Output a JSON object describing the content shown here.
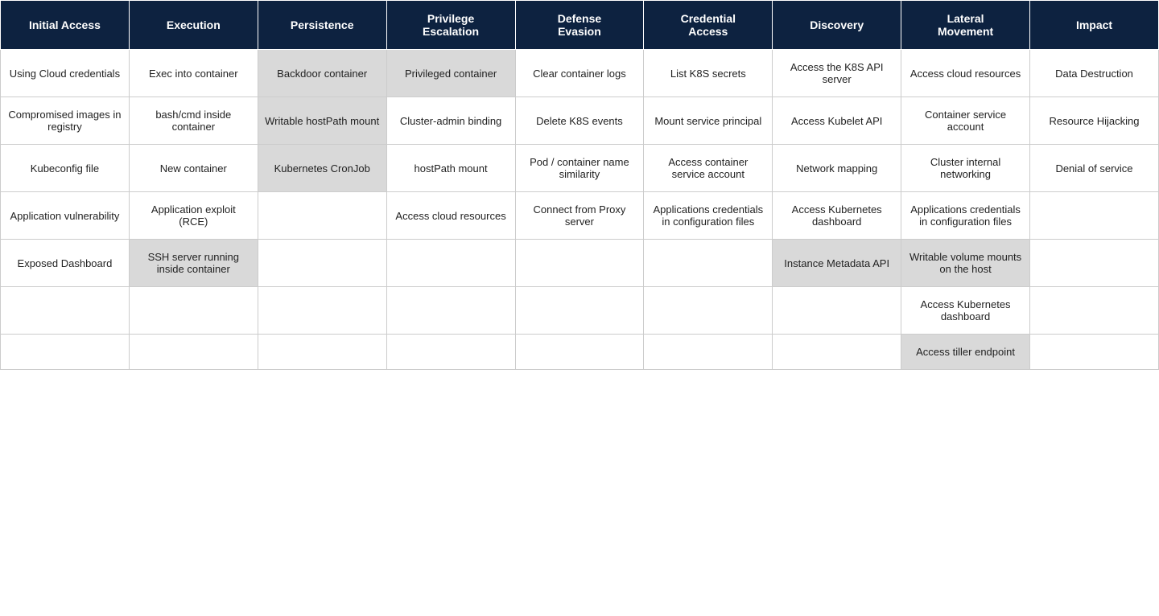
{
  "headers": [
    "Initial Access",
    "Execution",
    "Persistence",
    "Privilege Escalation",
    "Defense Evasion",
    "Credential Access",
    "Discovery",
    "Lateral Movement",
    "Impact"
  ],
  "rows": [
    [
      {
        "text": "Using Cloud credentials",
        "shaded": false
      },
      {
        "text": "Exec into container",
        "shaded": false
      },
      {
        "text": "Backdoor container",
        "shaded": true
      },
      {
        "text": "Privileged container",
        "shaded": true
      },
      {
        "text": "Clear container logs",
        "shaded": false
      },
      {
        "text": "List K8S secrets",
        "shaded": false
      },
      {
        "text": "Access the K8S API server",
        "shaded": false
      },
      {
        "text": "Access cloud resources",
        "shaded": false
      },
      {
        "text": "Data Destruction",
        "shaded": false
      }
    ],
    [
      {
        "text": "Compromised images in registry",
        "shaded": false
      },
      {
        "text": "bash/cmd inside container",
        "shaded": false
      },
      {
        "text": "Writable hostPath mount",
        "shaded": true
      },
      {
        "text": "Cluster-admin binding",
        "shaded": false
      },
      {
        "text": "Delete K8S events",
        "shaded": false
      },
      {
        "text": "Mount service principal",
        "shaded": false
      },
      {
        "text": "Access Kubelet API",
        "shaded": false
      },
      {
        "text": "Container service account",
        "shaded": false
      },
      {
        "text": "Resource Hijacking",
        "shaded": false
      }
    ],
    [
      {
        "text": "Kubeconfig file",
        "shaded": false
      },
      {
        "text": "New container",
        "shaded": false
      },
      {
        "text": "Kubernetes CronJob",
        "shaded": true
      },
      {
        "text": "hostPath mount",
        "shaded": false
      },
      {
        "text": "Pod / container name similarity",
        "shaded": false
      },
      {
        "text": "Access container service account",
        "shaded": false
      },
      {
        "text": "Network mapping",
        "shaded": false
      },
      {
        "text": "Cluster internal networking",
        "shaded": false
      },
      {
        "text": "Denial of service",
        "shaded": false
      }
    ],
    [
      {
        "text": "Application vulnerability",
        "shaded": false
      },
      {
        "text": "Application exploit (RCE)",
        "shaded": false
      },
      {
        "text": "",
        "shaded": false
      },
      {
        "text": "Access cloud resources",
        "shaded": false
      },
      {
        "text": "Connect from Proxy server",
        "shaded": false
      },
      {
        "text": "Applications credentials in configuration files",
        "shaded": false
      },
      {
        "text": "Access Kubernetes dashboard",
        "shaded": false
      },
      {
        "text": "Applications credentials in configuration files",
        "shaded": false
      },
      {
        "text": "",
        "shaded": false
      }
    ],
    [
      {
        "text": "Exposed Dashboard",
        "shaded": false
      },
      {
        "text": "SSH server running inside container",
        "shaded": true
      },
      {
        "text": "",
        "shaded": false
      },
      {
        "text": "",
        "shaded": false
      },
      {
        "text": "",
        "shaded": false
      },
      {
        "text": "",
        "shaded": false
      },
      {
        "text": "Instance Metadata API",
        "shaded": true
      },
      {
        "text": "Writable volume mounts on the host",
        "shaded": true
      },
      {
        "text": "",
        "shaded": false
      }
    ],
    [
      {
        "text": "",
        "shaded": false
      },
      {
        "text": "",
        "shaded": false
      },
      {
        "text": "",
        "shaded": false
      },
      {
        "text": "",
        "shaded": false
      },
      {
        "text": "",
        "shaded": false
      },
      {
        "text": "",
        "shaded": false
      },
      {
        "text": "",
        "shaded": false
      },
      {
        "text": "Access Kubernetes dashboard",
        "shaded": false
      },
      {
        "text": "",
        "shaded": false
      }
    ],
    [
      {
        "text": "",
        "shaded": false
      },
      {
        "text": "",
        "shaded": false
      },
      {
        "text": "",
        "shaded": false
      },
      {
        "text": "",
        "shaded": false
      },
      {
        "text": "",
        "shaded": false
      },
      {
        "text": "",
        "shaded": false
      },
      {
        "text": "",
        "shaded": false
      },
      {
        "text": "Access tiller endpoint",
        "shaded": true
      },
      {
        "text": "",
        "shaded": false
      }
    ]
  ]
}
